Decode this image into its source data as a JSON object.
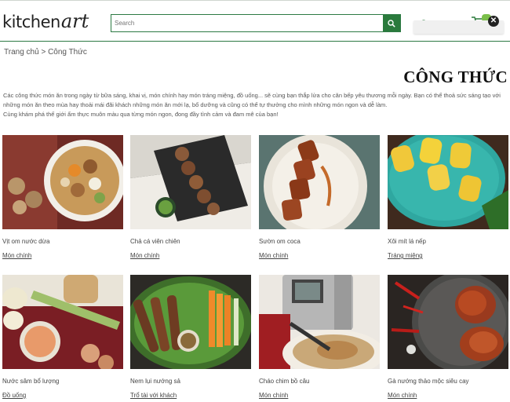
{
  "header": {
    "logo_left": "kitchen",
    "logo_right": "art",
    "search_placeholder": "Search"
  },
  "breadcrumb": {
    "home": "Trang chủ",
    "separator": ">",
    "current": "Công Thức"
  },
  "page_title": "CÔNG THỨC",
  "intro": [
    "Các công thức món ăn trong ngày từ bữa sáng, khai vị, món chính hay món tráng miệng, đồ uống... sẽ cùng bạn thắp lửa cho căn bếp yêu thương mỗi ngày. Bạn có thể thoả sức sáng tạo với những món ăn theo mùa hay thoải mái đãi khách những món ăn mới lạ, bổ dưỡng và cũng có thể tự thưởng cho mình những món ngon và dễ làm.",
    "Cùng khám phá thế giới ẩm thực muôn màu qua từng món ngon, đong đầy tình cảm và đam mê của bạn!"
  ],
  "recipes": [
    {
      "title": "Vịt om nước dừa",
      "category": "Món chính"
    },
    {
      "title": "Chả cá viên chiên",
      "category": "Món chính"
    },
    {
      "title": "Sườn om coca",
      "category": "Món chính"
    },
    {
      "title": "Xôi mít lá nếp",
      "category": "Tráng miệng"
    },
    {
      "title": "Nước sâm bổ lượng",
      "category": "Đồ uống"
    },
    {
      "title": "Nem lụi nướng sả",
      "category": "Trổ tài với khách"
    },
    {
      "title": "Cháo chim bồ câu",
      "category": "Món chính"
    },
    {
      "title": "Gà nướng thảo mộc siêu cay",
      "category": "Món chính"
    }
  ],
  "colors": {
    "brand_green": "#2a7a3c",
    "cart_badge": "#7bbf4a"
  },
  "icons": {
    "search": "search-icon",
    "user": "user-icon",
    "cart": "cart-icon",
    "close": "close-icon"
  }
}
